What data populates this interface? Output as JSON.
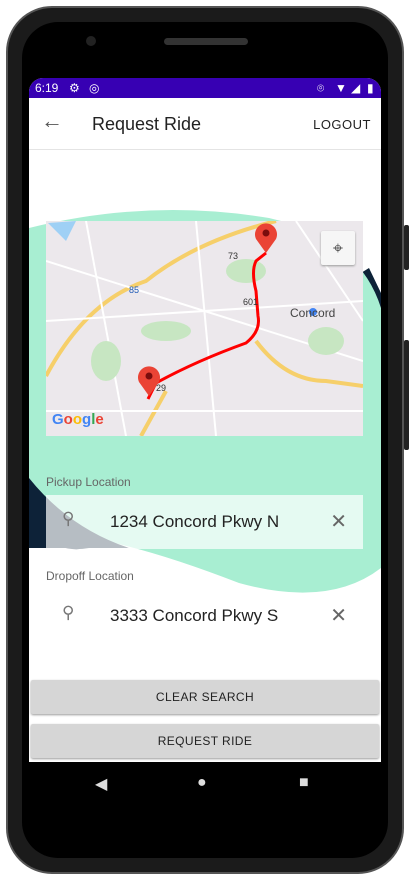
{
  "status": {
    "time": "6:19"
  },
  "appbar": {
    "title": "Request Ride",
    "logout": "LOGOUT"
  },
  "map": {
    "labels": {
      "city": "Concord",
      "r73": "73",
      "r85": "85",
      "r601": "601",
      "r29": "29"
    },
    "logo": "Google"
  },
  "pickup": {
    "label": "Pickup Location",
    "value": "1234 Concord Pkwy N"
  },
  "dropoff": {
    "label": "Dropoff Location",
    "value": "3333 Concord Pkwy S"
  },
  "buttons": {
    "clear": "CLEAR SEARCH",
    "request": "REQUEST RIDE"
  },
  "colors": {
    "status": "#3700b3",
    "mint": "#a8eed2",
    "navy": "#0d2238",
    "route": "#ff0000"
  }
}
